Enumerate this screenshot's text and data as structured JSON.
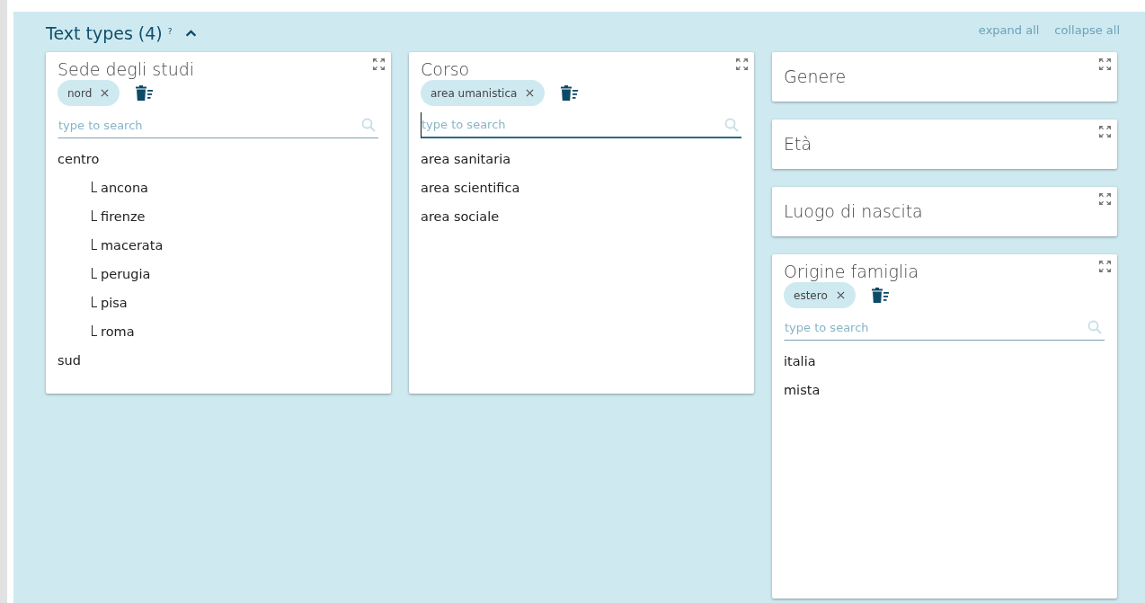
{
  "section": {
    "title": "Text types (4)",
    "help_mark": "?",
    "expanded": true
  },
  "links": [
    "expand all",
    "collapse all"
  ],
  "columns": [
    {
      "cards": [
        {
          "title": "Sede degli studi",
          "chips": [
            "nord"
          ],
          "search": {
            "placeholder": "type to search",
            "focused": false
          },
          "items": [
            {
              "label": "centro",
              "children": [
                {
                  "label": "ancona"
                },
                {
                  "label": "firenze"
                },
                {
                  "label": "macerata"
                },
                {
                  "label": "perugia"
                },
                {
                  "label": "pisa"
                },
                {
                  "label": "roma"
                }
              ]
            },
            {
              "label": "sud"
            }
          ]
        }
      ]
    },
    {
      "cards": [
        {
          "title": "Corso",
          "chips": [
            "area umanistica"
          ],
          "search": {
            "placeholder": "type to search",
            "focused": true
          },
          "items": [
            {
              "label": "area sanitaria"
            },
            {
              "label": "area scientifica"
            },
            {
              "label": "area sociale"
            }
          ]
        }
      ]
    },
    {
      "cards": [
        {
          "title": "Genere"
        },
        {
          "title": "Età"
        },
        {
          "title": "Luogo di nascita"
        },
        {
          "title": "Origine famiglia",
          "chips": [
            "estero"
          ],
          "search": {
            "placeholder": "type to search",
            "focused": false
          },
          "items": [
            {
              "label": "italia"
            },
            {
              "label": "mista"
            }
          ]
        }
      ]
    }
  ]
}
